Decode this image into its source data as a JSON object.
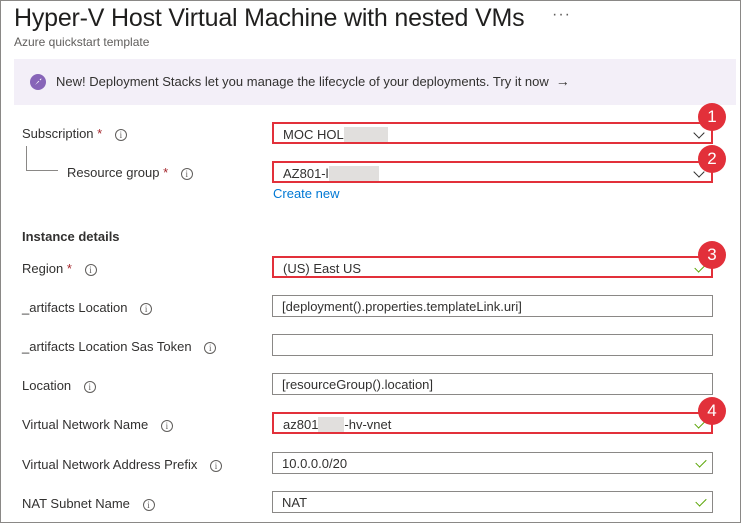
{
  "header": {
    "title": "Hyper-V Host Virtual Machine with nested VMs",
    "subtitle": "Azure quickstart template",
    "more_icon": "ellipsis-icon"
  },
  "banner": {
    "icon": "rocket-icon",
    "text": "New! Deployment Stacks let you manage the lifecycle of your deployments. Try it now",
    "arrow": "→"
  },
  "form": {
    "required_marker": "*",
    "subscription": {
      "label": "Subscription",
      "value": "MOC HOL"
    },
    "resource_group": {
      "label": "Resource group",
      "value": "AZ801-l",
      "create_new": "Create new"
    },
    "instance_details": "Instance details",
    "region": {
      "label": "Region",
      "value": "(US) East US"
    },
    "artifacts_location": {
      "label": "_artifacts Location",
      "value": "[deployment().properties.templateLink.uri]"
    },
    "artifacts_sas": {
      "label": "_artifacts Location Sas Token",
      "value": ""
    },
    "location": {
      "label": "Location",
      "value": "[resourceGroup().location]"
    },
    "vnet_name": {
      "label": "Virtual Network Name",
      "value_prefix": "az801",
      "value_suffix": "-hv-vnet"
    },
    "vnet_prefix": {
      "label": "Virtual Network Address Prefix",
      "value": "10.0.0.0/20"
    },
    "nat_subnet": {
      "label": "NAT Subnet Name",
      "value": "NAT"
    }
  },
  "callouts": [
    "1",
    "2",
    "3",
    "4"
  ],
  "colors": {
    "highlight": "#e2303a",
    "link": "#0078d4",
    "valid": "#57a300",
    "banner_bg": "#f3eff8",
    "required": "#a4262c"
  }
}
